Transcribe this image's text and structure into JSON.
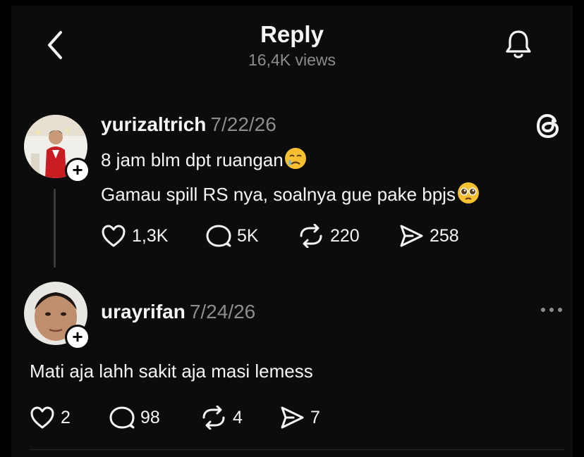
{
  "header": {
    "title": "Reply",
    "views": "16,4K views"
  },
  "posts": [
    {
      "username": "yurizaltrich",
      "date": "7/22/26",
      "lines": [
        "8 jam blm dpt ruangan",
        "Gamau spill RS nya, soalnya gue pake bpjs"
      ],
      "emojis": [
        "crying-face",
        "pleading-face"
      ],
      "likes": "1,3K",
      "replies": "5K",
      "reposts": "220",
      "shares": "258"
    },
    {
      "username": "urayrifan",
      "date": "7/24/26",
      "lines": [
        "Mati aja lahh sakit aja masi lemess"
      ],
      "likes": "2",
      "replies": "98",
      "reposts": "4",
      "shares": "7"
    }
  ],
  "icons": [
    "back-arrow-icon",
    "bell-icon",
    "threads-logo-icon",
    "more-icon",
    "heart-icon",
    "comment-icon",
    "repost-icon",
    "share-icon",
    "plus-icon"
  ],
  "colors": {
    "background": "#0c0c0c",
    "text": "#f3f5f7",
    "muted": "#8c8c8c"
  }
}
